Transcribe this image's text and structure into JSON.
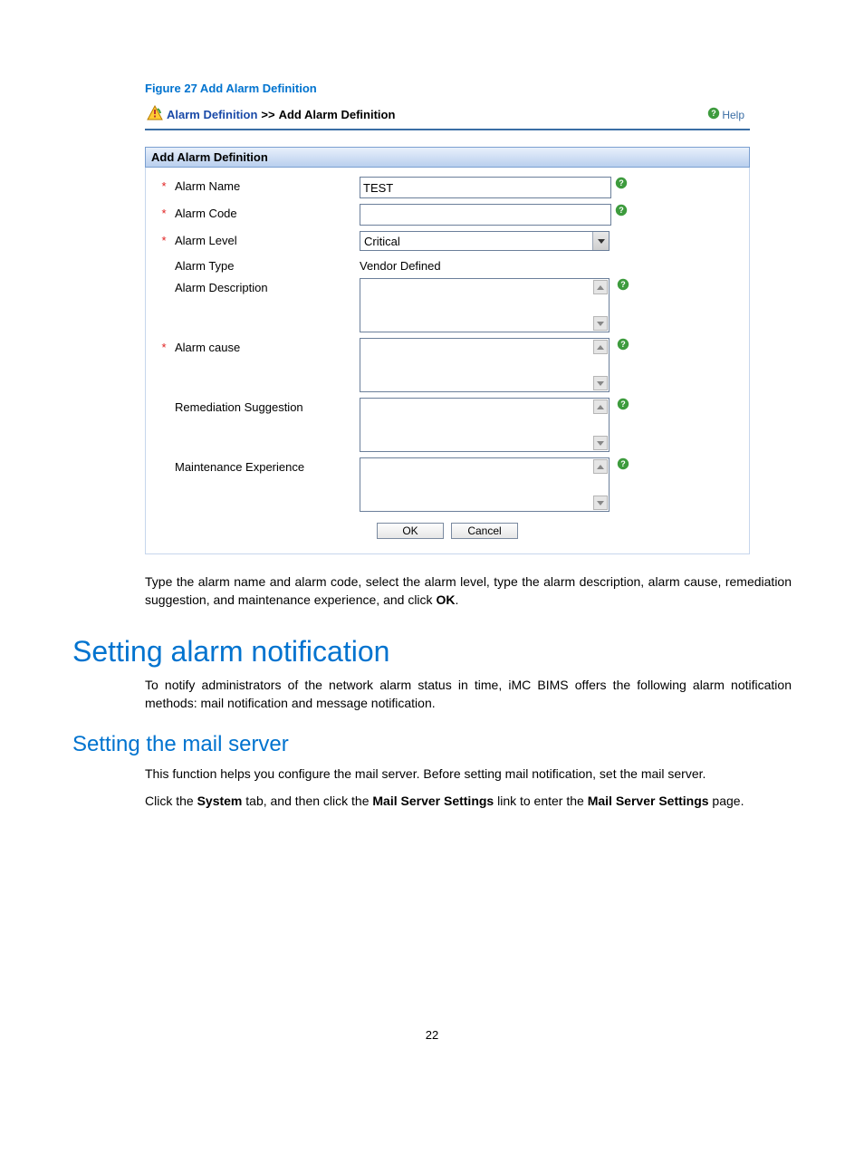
{
  "figure_caption": "Figure 27 Add Alarm Definition",
  "breadcrumb": {
    "link": "Alarm Definition",
    "sep": ">>",
    "current": "Add Alarm Definition"
  },
  "help_link": "Help",
  "section_title": "Add Alarm Definition",
  "fields": {
    "alarm_name": {
      "label": "Alarm Name",
      "value": "TEST"
    },
    "alarm_code": {
      "label": "Alarm Code",
      "value": ""
    },
    "alarm_level": {
      "label": "Alarm Level",
      "value": "Critical"
    },
    "alarm_type": {
      "label": "Alarm Type",
      "value": "Vendor Defined"
    },
    "alarm_description": {
      "label": "Alarm Description",
      "value": ""
    },
    "alarm_cause": {
      "label": "Alarm cause",
      "value": ""
    },
    "remediation": {
      "label": "Remediation Suggestion",
      "value": ""
    },
    "maintenance": {
      "label": "Maintenance Experience",
      "value": ""
    }
  },
  "buttons": {
    "ok": "OK",
    "cancel": "Cancel"
  },
  "para1_a": "Type the alarm name and alarm code, select the alarm level, type the alarm description, alarm cause, remediation suggestion, and maintenance experience, and click ",
  "para1_b": "OK",
  "para1_c": ".",
  "h1": "Setting alarm notification",
  "para2": "To notify administrators of the network alarm status in time, iMC BIMS offers the following alarm notification methods: mail notification and message notification.",
  "h2": "Setting the mail server",
  "para3": "This function helps you configure the mail server. Before setting mail notification, set the mail server.",
  "para4_a": "Click the ",
  "para4_b": "System",
  "para4_c": " tab, and then click the ",
  "para4_d": "Mail Server Settings",
  "para4_e": " link to enter the ",
  "para4_f": "Mail Server Settings",
  "para4_g": " page.",
  "page_number": "22"
}
